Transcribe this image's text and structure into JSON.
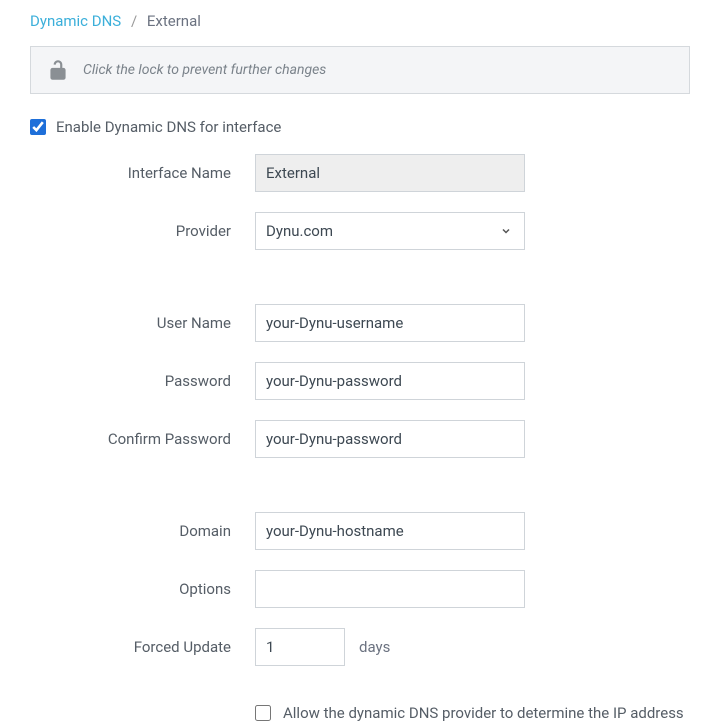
{
  "breadcrumb": {
    "parent": "Dynamic DNS",
    "separator": "/",
    "current": "External"
  },
  "lock_bar": {
    "text": "Click the lock to prevent further changes"
  },
  "enable": {
    "label": "Enable Dynamic DNS for interface",
    "checked": true
  },
  "fields": {
    "interface_name": {
      "label": "Interface Name",
      "value": "External"
    },
    "provider": {
      "label": "Provider",
      "value": "Dynu.com"
    },
    "user_name": {
      "label": "User Name",
      "value": "your-Dynu-username"
    },
    "password": {
      "label": "Password",
      "value": "your-Dynu-password"
    },
    "confirm_password": {
      "label": "Confirm Password",
      "value": "your-Dynu-password"
    },
    "domain": {
      "label": "Domain",
      "value": "your-Dynu-hostname"
    },
    "options": {
      "label": "Options",
      "value": ""
    },
    "forced_update": {
      "label": "Forced Update",
      "value": "1",
      "unit": "days"
    },
    "allow_provider_ip": {
      "label": "Allow the dynamic DNS provider to determine the IP address",
      "checked": false
    }
  }
}
